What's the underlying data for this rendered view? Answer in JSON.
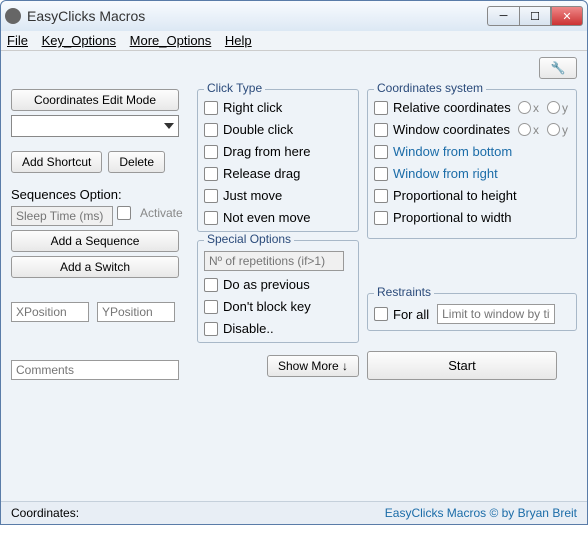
{
  "window": {
    "title": "EasyClicks Macros"
  },
  "menu": {
    "file": "File",
    "key_options": "Key_Options",
    "more_options": "More_Options",
    "help": "Help"
  },
  "buttons": {
    "edit_mode": "Coordinates Edit Mode",
    "add_shortcut": "Add Shortcut",
    "delete": "Delete",
    "add_sequence": "Add a Sequence",
    "add_switch": "Add a Switch",
    "show_more": "Show More ↓",
    "start": "Start"
  },
  "labels": {
    "seq_option": "Sequences Option:",
    "sleep_time": "Sleep Time (ms)",
    "activate": "Activate",
    "xpos": "XPosition",
    "ypos": "YPosition",
    "comments": "Comments",
    "repetitions": "Nº of repetitions (if>1)",
    "limit_window": "Limit to window by title",
    "coordinates": "Coordinates:",
    "x": "x",
    "y": "y"
  },
  "groups": {
    "click_type": "Click Type",
    "special": "Special Options",
    "coord_sys": "Coordinates system",
    "restraints": "Restraints"
  },
  "click_type": {
    "right": "Right click",
    "double": "Double click",
    "drag_from": "Drag from here",
    "release": "Release drag",
    "just_move": "Just move",
    "not_move": "Not even move"
  },
  "special": {
    "do_prev": "Do as previous",
    "dont_block": "Don't block key",
    "disable": "Disable.."
  },
  "coord_sys": {
    "relative": "Relative coordinates",
    "window": "Window coordinates",
    "win_bottom": "Window from bottom",
    "win_right": "Window from right",
    "prop_h": "Proportional to height",
    "prop_w": "Proportional to width"
  },
  "restraints": {
    "for_all": "For all"
  },
  "footer": {
    "credits": "EasyClicks Macros © by Bryan Breit"
  }
}
